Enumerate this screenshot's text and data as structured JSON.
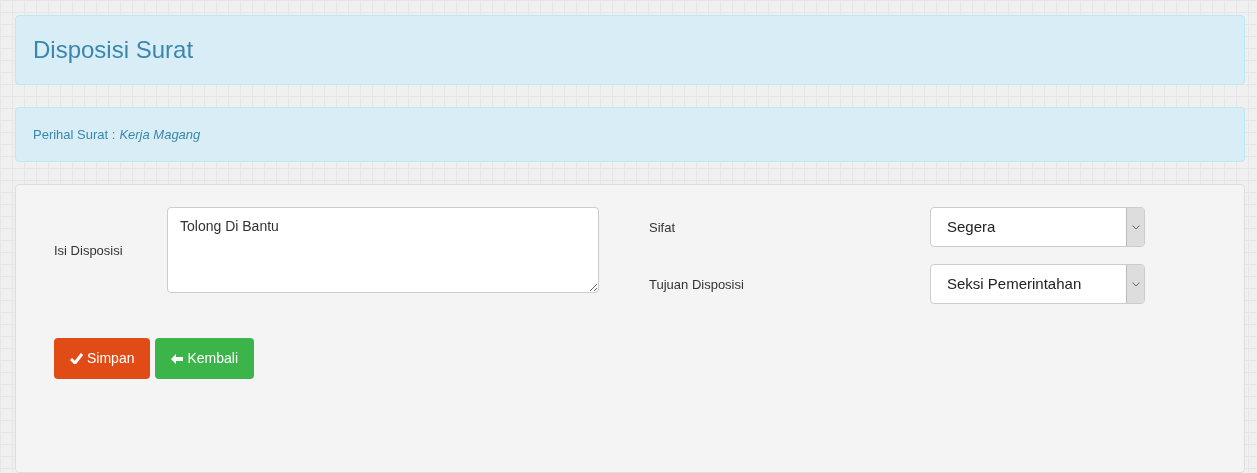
{
  "header": {
    "title": "Disposisi Surat"
  },
  "subject": {
    "label": "Perihal Surat :",
    "value": "Kerja Magang"
  },
  "form": {
    "message": {
      "label": "Isi Disposisi",
      "value": "Tolong Di Bantu"
    },
    "selects": [
      {
        "label": "Sifat",
        "value": "Segera"
      },
      {
        "label": "Tujuan Disposisi",
        "value": "Seksi Pemerintahan"
      }
    ],
    "buttons": [
      {
        "kind": "save",
        "label": "Simpan"
      },
      {
        "kind": "back",
        "label": "Kembali"
      }
    ]
  }
}
